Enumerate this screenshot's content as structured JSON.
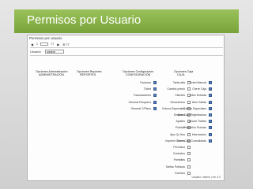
{
  "slide": {
    "title": "Permisos por Usuario"
  },
  "window": {
    "title": "Permisos por usuario",
    "toolbar": [
      "1",
      "77",
      "⊕ 77",
      "◀",
      "▶"
    ],
    "filter_label": "Usuario",
    "filter_value": "sistem",
    "status_text": "Usuario: sistem | ver 4.0"
  },
  "columns": [
    {
      "header": [
        "Opciones Administración",
        "ADMINISTRACIÓN"
      ],
      "items": [
        {
          "label": "Tarifa alta",
          "checked": false
        },
        {
          "label": "Cambio precio",
          "checked": false
        },
        {
          "label": "Clientes",
          "checked": false
        },
        {
          "label": "Descuentos",
          "checked": false
        },
        {
          "label": "Cobros Especiales",
          "checked": false
        },
        {
          "label": "Empresa",
          "checked": false
        },
        {
          "label": "Ajustes",
          "checked": false
        },
        {
          "label": "Policías",
          "checked": false
        },
        {
          "label": "Ajus Qr Hoy",
          "checked": false
        },
        {
          "label": "Turnos",
          "checked": false
        },
        {
          "label": "Permisos",
          "checked": false
        },
        {
          "label": "Contratos",
          "checked": false
        },
        {
          "label": "Pantallas",
          "checked": false
        },
        {
          "label": "Tarifas Públicas",
          "checked": false
        },
        {
          "label": "Eventos",
          "checked": false
        }
      ]
    },
    {
      "header": [
        "Opciones Reportes",
        "REPORTES"
      ],
      "items": []
    },
    {
      "header": [
        "Opciones Configuración",
        "CONFIGURACIÓN"
      ],
      "items": [
        {
          "label": "Facturas",
          "checked": true
        },
        {
          "label": "Ticket",
          "checked": true
        },
        {
          "label": "Facturaciones",
          "checked": true
        },
        {
          "label": "General Parqueos",
          "checked": true
        },
        {
          "label": "General C/Pisos",
          "checked": true
        }
      ]
    },
    {
      "header": [
        "Opciones Caja",
        "CAJA"
      ],
      "items": [
        {
          "label": "Ticket Manual",
          "checked": true
        },
        {
          "label": "Cierre Caja",
          "checked": true
        },
        {
          "label": "Abre Entrada",
          "checked": true
        },
        {
          "label": "Abre Salida",
          "checked": true
        },
        {
          "label": "Cobros Especiales",
          "checked": true
        },
        {
          "label": "Abre Caja Registradora",
          "checked": true
        },
        {
          "label": "Anular Tickets",
          "checked": true
        },
        {
          "label": "Pequeños Rondas",
          "checked": true
        },
        {
          "label": "Información",
          "checked": true
        },
        {
          "label": "Imprimir Cierre Caja Consolidado",
          "checked": true
        }
      ]
    }
  ]
}
